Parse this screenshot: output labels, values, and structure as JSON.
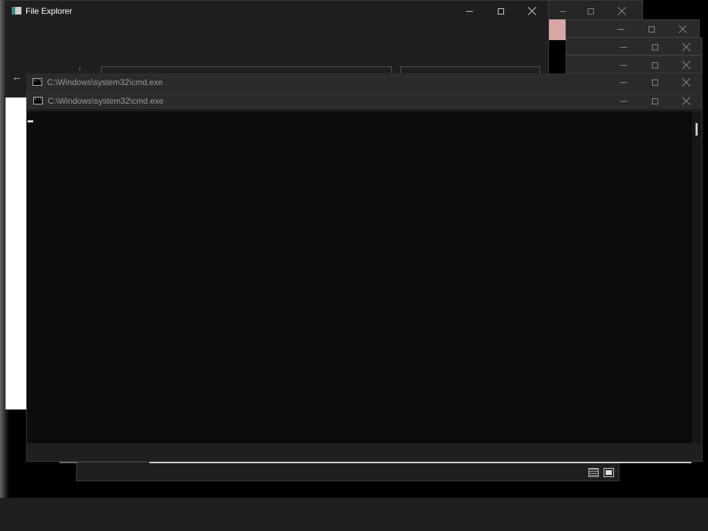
{
  "file_explorer": {
    "title": "File Explorer",
    "back_glyph": "←",
    "up_glyph": "↑"
  },
  "cmd_windows": [
    {
      "title": "C:\\Windows\\system32\\cmd.exe"
    },
    {
      "title": "C:\\Windows\\system32\\cmd.exe"
    }
  ],
  "icons": {
    "app": "file-explorer-app-icon",
    "cmd": "cmd-app-icon",
    "details_view": "details-view-icon",
    "large_icons_view": "large-icons-view-icon"
  },
  "colors": {
    "titlebar_dark": "#1f1f1f",
    "cmd_titlebar": "#2b2b2b",
    "console_bg": "#0c0c0c",
    "accent_pink": "#d9a6a6"
  }
}
